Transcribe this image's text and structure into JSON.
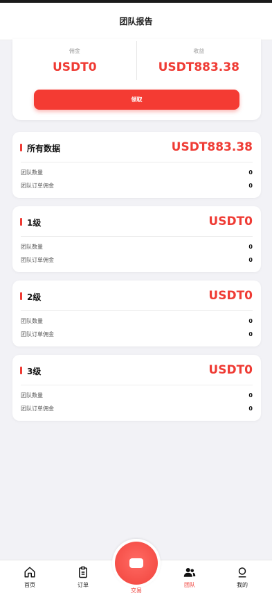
{
  "header": {
    "title": "团队报告"
  },
  "summary": {
    "commission_label": "佣金",
    "commission_value": "USDT0",
    "earnings_label": "收益",
    "earnings_value": "USDT883.38",
    "claim_label": "领取"
  },
  "cards": [
    {
      "title": "所有数据",
      "amount": "USDT883.38",
      "rows": [
        {
          "label": "团队数量",
          "value": "0"
        },
        {
          "label": "团队订单佣金",
          "value": "0"
        }
      ]
    },
    {
      "title": "1级",
      "amount": "USDT0",
      "rows": [
        {
          "label": "团队数量",
          "value": "0"
        },
        {
          "label": "团队订单佣金",
          "value": "0"
        }
      ]
    },
    {
      "title": "2级",
      "amount": "USDT0",
      "rows": [
        {
          "label": "团队数量",
          "value": "0"
        },
        {
          "label": "团队订单佣金",
          "value": "0"
        }
      ]
    },
    {
      "title": "3级",
      "amount": "USDT0",
      "rows": [
        {
          "label": "团队数量",
          "value": "0"
        },
        {
          "label": "团队订单佣金",
          "value": "0"
        }
      ]
    }
  ],
  "tabbar": {
    "home": "首页",
    "orders": "订单",
    "trade": "交易",
    "team": "团队",
    "mine": "我的",
    "active": "team"
  },
  "colors": {
    "accent": "#ef3b34",
    "background": "#f2f2f6"
  },
  "icons": {
    "home": "home-icon",
    "orders": "clipboard-icon",
    "trade": "trade-icon",
    "team": "team-icon",
    "mine": "user-icon"
  }
}
